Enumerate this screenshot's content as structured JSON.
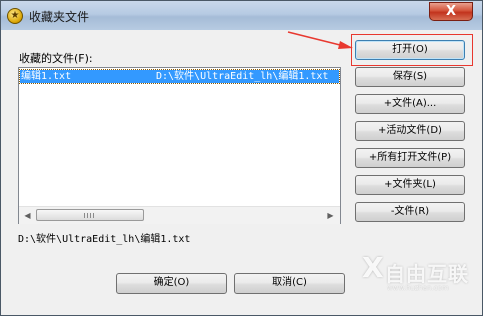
{
  "window": {
    "title": "收藏夹文件",
    "close_symbol": "X"
  },
  "favorites": {
    "label": "收藏的文件(F):",
    "items": [
      {
        "name": "编辑1.txt",
        "path": "D:\\软件\\UltraEdit_lh\\编辑1.txt"
      }
    ],
    "selected_path": "D:\\软件\\UltraEdit_lh\\编辑1.txt"
  },
  "side_buttons": {
    "open": "打开(O)",
    "save": "保存(S)",
    "add_file": "+文件(A)...",
    "add_active": "+活动文件(D)",
    "add_all_open": "+所有打开文件(P)",
    "add_folder": "+文件夹(L)",
    "remove_file": "-文件(R)"
  },
  "footer": {
    "ok": "确定(O)",
    "cancel": "取消(C)"
  },
  "watermark": {
    "mark": "X",
    "text": "自由互联",
    "url": "www.huzhan.com"
  },
  "colors": {
    "selection": "#3399ff",
    "annotation": "#e8382f",
    "titlebar": "#b6cbe3"
  },
  "icons": {
    "app": "favorites-star-icon",
    "close": "close-icon",
    "scroll_left": "scroll-left-arrow-icon",
    "scroll_right": "scroll-right-arrow-icon"
  }
}
